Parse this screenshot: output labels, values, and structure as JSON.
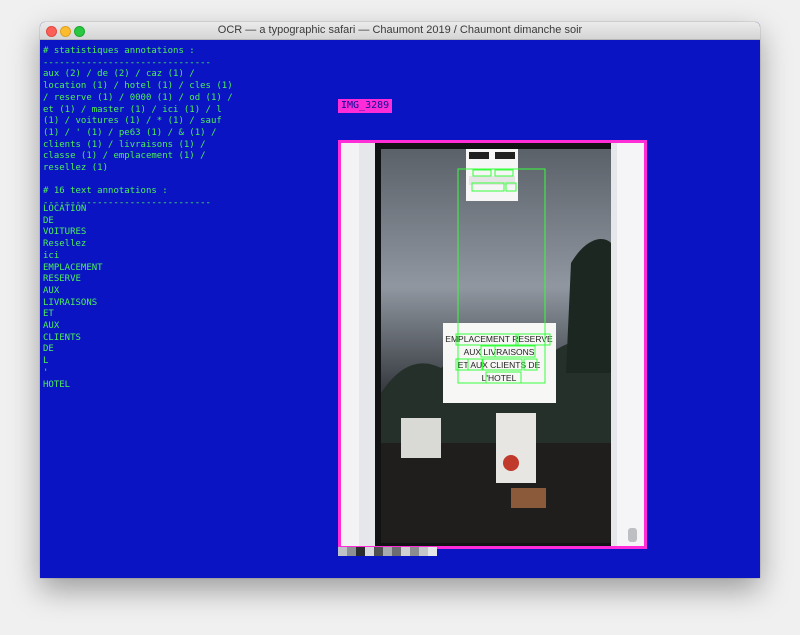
{
  "window": {
    "title": "OCR — a typographic safari — Chaumont 2019 / Chaumont dimanche soir"
  },
  "stats": {
    "lines": [
      "# statistiques annotations :",
      "-------------------------------",
      "aux (2) / de (2) / caz (1) /",
      "location (1) / hotel (1) / cles (1)",
      "/ reserve (1) / 0000 (1) / od (1) /",
      "et (1) / master (1) / ici (1) / l",
      "(1) / voitures (1) / * (1) / sauf",
      "(1) / ' (1) / pe63 (1) / & (1) /",
      "clients (1) / livraisons (1) /",
      "classe (1) / emplacement (1) /",
      "resellez (1)",
      "",
      "# 16 text annotations :",
      "-------------------------------",
      "",
      ""
    ]
  },
  "annotations": {
    "words": [
      "LOCATION",
      "DE",
      "VOITURES",
      "Resellez",
      "ici",
      "EMPLACEMENT",
      "RESERVE",
      "AUX",
      "LIVRAISONS",
      "ET",
      "AUX",
      "CLIENTS",
      "DE",
      "L",
      "'",
      "HOTEL"
    ]
  },
  "image": {
    "label": "IMG_3289",
    "sign_lines": [
      "EMPLACEMENT RESERVE",
      "AUX LIVRAISONS",
      "ET AUX CLIENTS DE",
      "L'HOTEL"
    ],
    "notice_top": [
      "caz 0000",
      "Resellez ici"
    ]
  },
  "palette": {
    "colors": [
      "#bfc2c6",
      "#8e9194",
      "#2a2c2e",
      "#d7d9dc",
      "#4e5052",
      "#a9acaf",
      "#6b6d70",
      "#d0d0d2",
      "#8a8c8f",
      "#c4c6c9",
      "#e5e6e8"
    ]
  },
  "colors": {
    "background": "#0b14c2",
    "text": "#4cf05a",
    "highlight": "#ff2cd8",
    "box": "#36ff3b"
  }
}
